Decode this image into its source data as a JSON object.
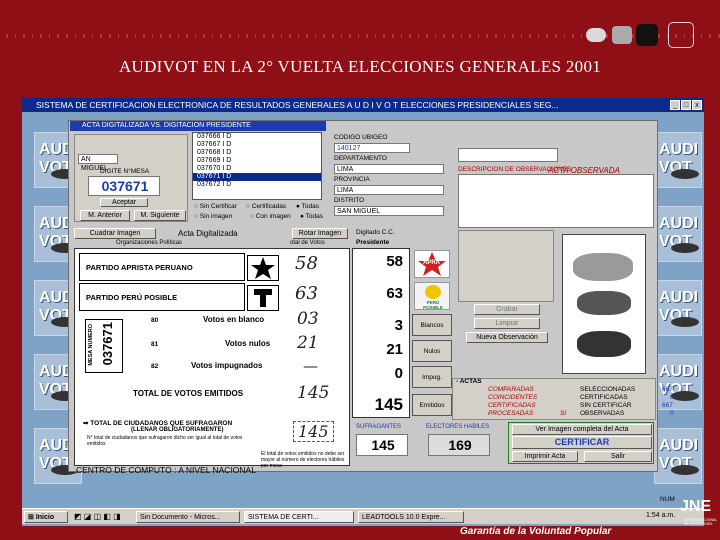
{
  "slide": {
    "title": "AUDIVOT EN LA 2° VUELTA ELECCIONES GENERALES 2001",
    "footer": "Garantía de la Voluntad Popular",
    "logo": "JNE",
    "logo_sub": "JURADO NACIONAL DE ELECCIONES",
    "side_logo": "AUDI VOT"
  },
  "window": {
    "title": "SISTEMA DE CERTIFICACION ELECTRONICA DE RESULTADOS GENERALES    A U D I V O T    ELECCIONES PRESIDENCIALES    SEG...",
    "controls": [
      "_",
      "□",
      "x"
    ],
    "tab": "ACTA DIGITALIZADA VS. DIGITACION PRESIDENTE"
  },
  "left_panel": {
    "mesa_label": "AN MIGUEL",
    "mesa_caption": "DIGITE N°MESA",
    "mesa_value": "037671",
    "accept_btn": "Aceptar",
    "prev_btn": "M. Anterior",
    "next_btn": "M. Siguiente",
    "list": [
      {
        "code": "037666",
        "flag": "I",
        "mark": "D"
      },
      {
        "code": "037667",
        "flag": "I",
        "mark": "D"
      },
      {
        "code": "037668",
        "flag": "I",
        "mark": "D"
      },
      {
        "code": "037669",
        "flag": "I",
        "mark": "D"
      },
      {
        "code": "037670",
        "flag": "I",
        "mark": "D"
      },
      {
        "code": "037671",
        "flag": "I",
        "mark": "D"
      },
      {
        "code": "037672",
        "flag": "I",
        "mark": "D"
      }
    ],
    "radios_top": [
      "Sin Certificar",
      "Certificadas",
      "Todas"
    ],
    "radios_bottom": [
      "Sin imagen",
      "Con imagen",
      "Todas"
    ]
  },
  "location": {
    "code_label": "CODIGO UBIGEO",
    "code": "140127",
    "dept_label": "DEPARTAMENTO",
    "dept": "LIMA",
    "prov_label": "PROVINCIA",
    "prov": "LIMA",
    "dist_label": "DISTRITO",
    "dist": "SAN MIGUEL"
  },
  "observ": {
    "title_label": "DESCRIPCION DE OBSERVACIONES",
    "stamp": "ACTA OBSERVADA"
  },
  "toolbar": {
    "zoom_btn": "Cuadrar Imagen",
    "acta_label": "Acta Digitalizada",
    "rotate_btn": "Rotar Imagen",
    "digitado_label": "Digitado C.C.",
    "presidente_label": "Presidente",
    "org_label": "Organizaciones Políticas",
    "total_label": "otal de Votos"
  },
  "acta": {
    "parties": [
      {
        "name": "PARTIDO APRISTA PERUANO",
        "handwritten": "58",
        "digitado": "58"
      },
      {
        "name": "PARTIDO PERÚ POSIBLE",
        "handwritten": "63",
        "digitado": "63"
      }
    ],
    "mesa_numero_label": "MESA NUMERO",
    "mesa_numero": "037671",
    "rows": [
      {
        "code": "80",
        "label": "Votos en blanco",
        "handwritten": "03",
        "digitado": "3",
        "stat": "Blancos"
      },
      {
        "code": "81",
        "label": "Votos nulos",
        "handwritten": "21",
        "digitado": "21",
        "stat": "Nulos"
      },
      {
        "code": "82",
        "label": "Votos impugnados",
        "handwritten": "—",
        "digitado": "0",
        "stat": "Impug."
      }
    ],
    "total_label": "TOTAL DE VOTOS EMITIDOS",
    "total_handwritten": "145",
    "total_digitado": "145",
    "total_stat": "Emitidos",
    "ciudadanos_label": "TOTAL DE CIUDADANOS QUE SUFRAGARON",
    "ciudadanos_sub": "(LLENAR OBLIGATORIAMENTE)",
    "ciudadanos_note": "N° total de ciudadanos que sufragaron dicho ser igual al total de votos emitidos",
    "ciudadanos_handwritten": "145",
    "footer_note": "El total de votos emitidos no debe ser mayor al número de electores hábiles por mesa"
  },
  "bottom": {
    "centro": "CENTRO DE COMPUTO : A NIVEL NACIONAL",
    "sufragantes_label": "SUFRAGANTES",
    "sufragantes": "145",
    "electores_label": "ELECTORES HABILES",
    "electores": "169"
  },
  "actions": {
    "grabar": "Grabar",
    "limpiar": "Limpiar",
    "nueva_obs": "Nueva Observación",
    "ver_imagen": "Ver Imagen completa del Acta",
    "certificar": "CERTIFICAR",
    "imprimir": "Imprimir Acta",
    "salir": "Salir"
  },
  "summary": {
    "heading": "ACTAS",
    "left": [
      "COMPARADAS",
      "COINCIDENTES",
      "CERTIFICADAS",
      "PROCESADAS"
    ],
    "right": [
      {
        "label": "SELECCIONADAS",
        "value": "667"
      },
      {
        "label": "CERTIFICADAS",
        "value": "0"
      },
      {
        "label": "SIN CERTIFICAR",
        "value": "667"
      },
      {
        "label": "OBSERVADAS",
        "value": "0"
      }
    ],
    "procesadas_value": "SI"
  },
  "logos": {
    "apra": "APRA",
    "peru_posible": "PERÚ POSIBLE"
  },
  "status": {
    "num": "NUM"
  },
  "taskbar": {
    "start": "Inicio",
    "tasks": [
      "Sin Documento - Micros...",
      "SISTEMA DE CERTI...",
      "LEADTOOLS 10.0 Expre..."
    ],
    "clock": "1:54 a.m."
  },
  "colors": {
    "slide_bg": "#8e0f15",
    "titlebar": "#0b2a8c",
    "app_bg": "#7ea3c7",
    "panel_bg": "#d4d0c8",
    "red_text": "#b00000"
  }
}
